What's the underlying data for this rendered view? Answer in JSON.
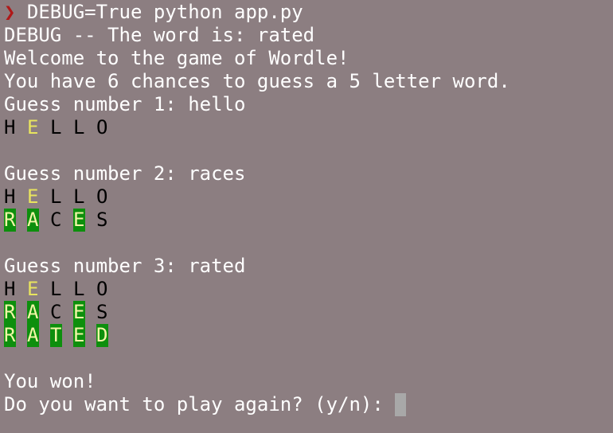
{
  "prompt": {
    "symbol": "❯",
    "command": "DEBUG=True python app.py"
  },
  "output": {
    "debug_line": "DEBUG -- The word is: rated",
    "welcome": "Welcome to the game of Wordle!",
    "chances": "You have 6 chances to guess a 5 letter word.",
    "guess1_label": "Guess number 1: hello",
    "guess2_label": "Guess number 2: races",
    "guess3_label": "Guess number 3: rated",
    "won": "You won!",
    "play_again": "Do you want to play again? (y/n): "
  },
  "boards": {
    "hello": [
      {
        "letter": "H",
        "state": "absent"
      },
      {
        "letter": "E",
        "state": "present"
      },
      {
        "letter": "L",
        "state": "absent"
      },
      {
        "letter": "L",
        "state": "absent"
      },
      {
        "letter": "O",
        "state": "absent"
      }
    ],
    "races": [
      {
        "letter": "R",
        "state": "correct"
      },
      {
        "letter": "A",
        "state": "correct"
      },
      {
        "letter": "C",
        "state": "absent"
      },
      {
        "letter": "E",
        "state": "correct"
      },
      {
        "letter": "S",
        "state": "absent"
      }
    ],
    "rated": [
      {
        "letter": "R",
        "state": "correct"
      },
      {
        "letter": "A",
        "state": "correct"
      },
      {
        "letter": "T",
        "state": "correct"
      },
      {
        "letter": "E",
        "state": "correct"
      },
      {
        "letter": "D",
        "state": "correct"
      }
    ]
  },
  "colors": {
    "background": "#8c7e81",
    "text": "#ffffff",
    "absent": "#000000",
    "present": "#e8e45e",
    "correct_bg": "#0d8f0d",
    "correct_text": "#f3f7a8",
    "prompt_arrow": "#b01818",
    "cursor": "#a8a8a8"
  }
}
